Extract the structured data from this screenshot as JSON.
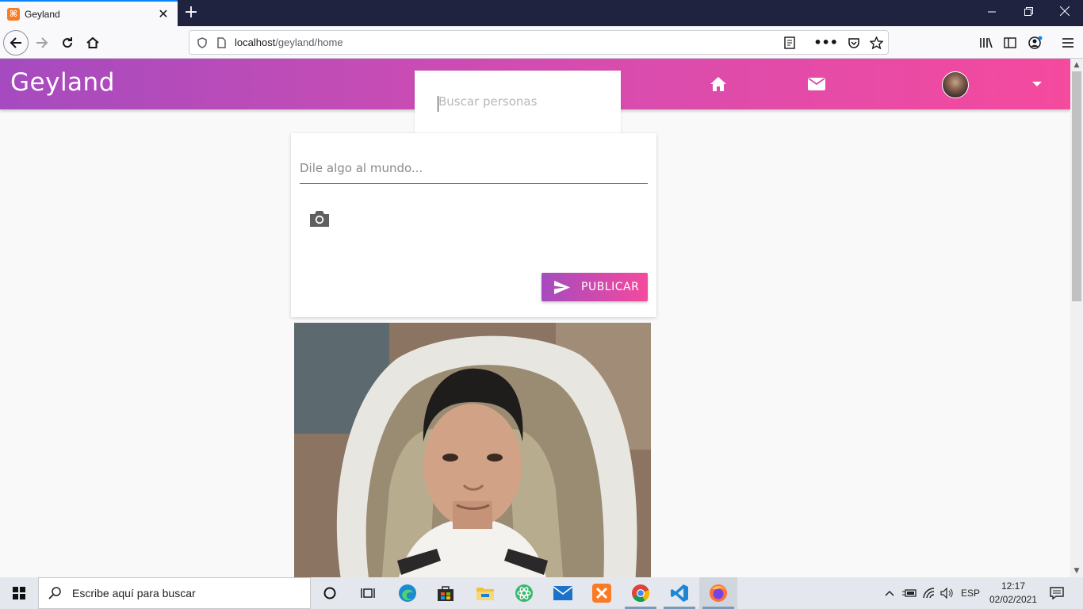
{
  "browser": {
    "tab_title": "Geyland",
    "tab_favicon_glyph": "⌘",
    "url_host": "localhost",
    "url_path": "/geyland/home"
  },
  "app": {
    "brand": "Geyland",
    "search_placeholder": "Buscar personas",
    "colors": {
      "gradient_start": "#a54bbf",
      "gradient_end": "#f54a9e"
    }
  },
  "composer": {
    "placeholder": "Dile algo al mundo...",
    "publish_label": "PUBLICAR"
  },
  "taskbar": {
    "search_placeholder": "Escribe aquí para buscar",
    "language": "ESP",
    "time": "12:17",
    "date": "02/02/2021"
  }
}
